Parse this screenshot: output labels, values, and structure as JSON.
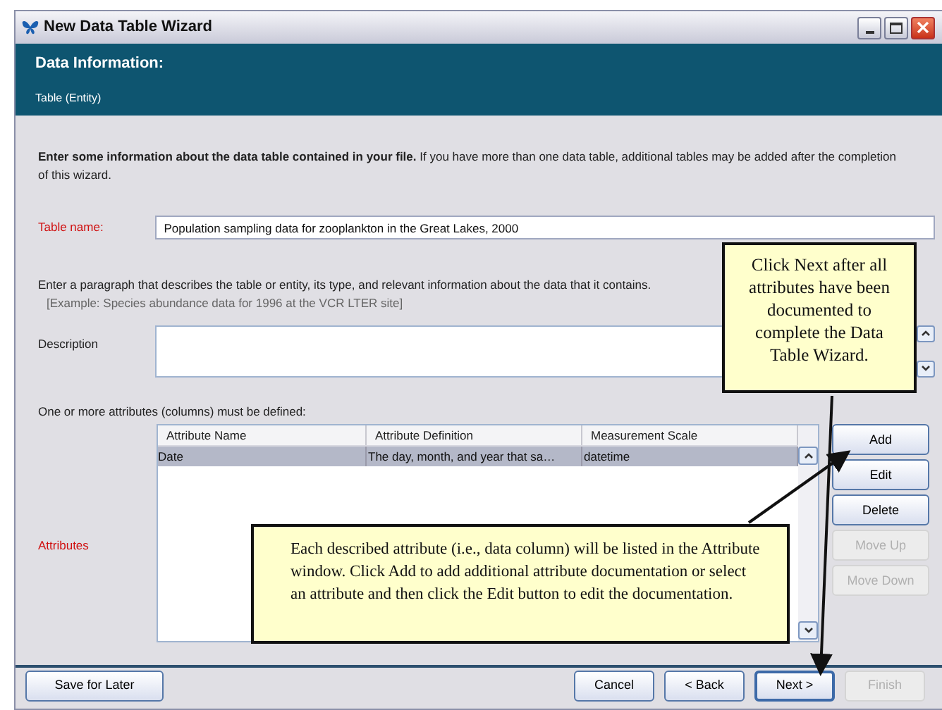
{
  "window": {
    "title": "New Data Table Wizard"
  },
  "header": {
    "title": "Data Information:",
    "subtitle": "Table (Entity)"
  },
  "intro": "**Enter some information about the data table contained in your file.** If you have more than one data table, additional tables may be added after the completion of this wizard.",
  "table_name": {
    "label": "Table name:",
    "value": "Population sampling data for zooplankton in the Great Lakes, 2000"
  },
  "description": {
    "prompt": "Enter a paragraph that describes the table or entity, its type, and relevant information about the data that it contains.",
    "example": "[Example:   Species abundance data for 1996 at the VCR LTER site]",
    "label": "Description"
  },
  "attributes": {
    "prompt": "One or more attributes (columns) must be defined:",
    "label": "Attributes",
    "columns": [
      "Attribute Name",
      "Attribute Definition",
      "Measurement Scale"
    ],
    "rows": [
      {
        "cells": [
          "Date",
          "The day, month, and year that sa…",
          "datetime"
        ],
        "selected": true
      }
    ]
  },
  "side_buttons": [
    {
      "label": "Add",
      "disabled": false
    },
    {
      "label": "Edit",
      "disabled": false
    },
    {
      "label": "Delete",
      "disabled": false
    },
    {
      "label": "Move Up",
      "disabled": true
    },
    {
      "label": "Move Down",
      "disabled": true
    }
  ],
  "footer": {
    "save": {
      "label": "Save for Later",
      "disabled": false
    },
    "buttons": [
      {
        "label": "Cancel",
        "disabled": false,
        "default": false
      },
      {
        "label": "< Back",
        "disabled": false,
        "default": false
      },
      {
        "label": "Next >",
        "disabled": false,
        "default": true
      },
      {
        "label": "Finish",
        "disabled": true,
        "default": false
      }
    ]
  },
  "callouts": [
    {
      "kind": "next",
      "text": "Click Next after all attributes have been documented to complete the Data Table Wizard."
    },
    {
      "kind": "attributes",
      "text": "Each described attribute (i.e., data column) will be listed in the Attribute window. Click Add to add additional attribute documentation or select an attribute and then click the Edit button to edit the documentation."
    }
  ]
}
